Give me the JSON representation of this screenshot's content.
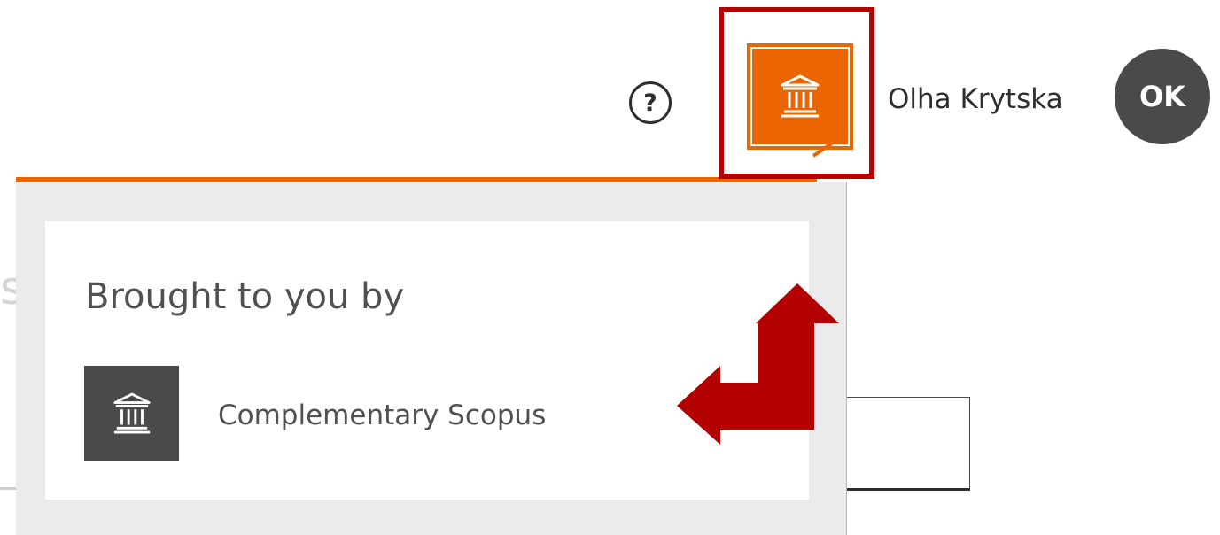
{
  "header": {
    "help_symbol": "?",
    "user_name": "Olha Krytska",
    "avatar_initials": "OK"
  },
  "background": {
    "partial_text": "s ("
  },
  "dropdown": {
    "heading": "Brought to you by",
    "institution_name": "Complementary Scopus"
  },
  "colors": {
    "accent_orange": "#eb6500",
    "annotation_red": "#b30000",
    "dark_gray": "#4a4a4a"
  },
  "icons": {
    "help": "question-circle-icon",
    "institution": "institution-building-icon",
    "annotation": "red-bent-arrow-icon"
  }
}
